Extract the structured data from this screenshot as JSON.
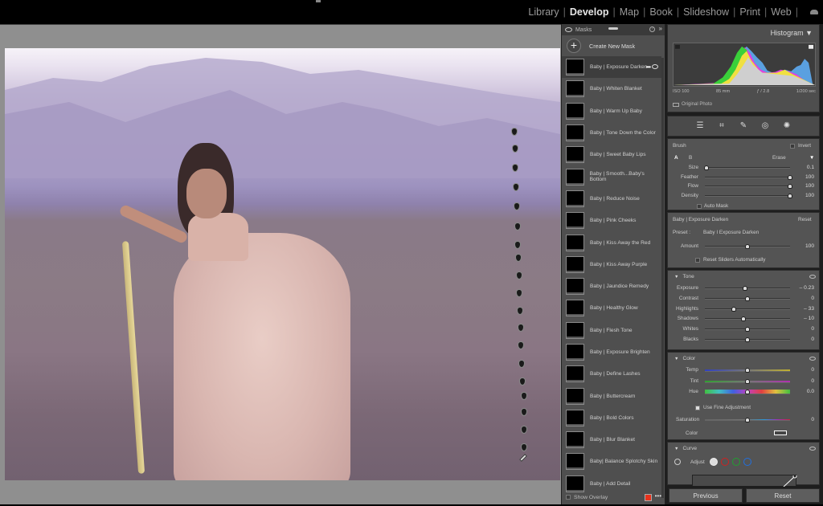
{
  "modules": {
    "items": [
      "Library",
      "Develop",
      "Map",
      "Book",
      "Slideshow",
      "Print",
      "Web"
    ],
    "active": "Develop"
  },
  "masks_panel": {
    "title": "Masks",
    "create_label": "Create New Mask",
    "items": [
      "Baby | Exposure Darken",
      "Baby | Whiten Blanket",
      "Baby | Warm Up Baby",
      "Baby | Tone Down the Color",
      "Baby | Sweet Baby Lips",
      "Baby | Smooth...Baby's Bottom",
      "Baby | Reduce Noise",
      "Baby | Pink Cheeks",
      "Baby | Kiss Away the Red",
      "Baby | Kiss Away Purple",
      "Baby | Jaundice Remedy",
      "Baby | Healthy Glow",
      "Baby | Flesh Tone",
      "Baby | Exposure Brighten",
      "Baby | Define Lashes",
      "Baby | Buttercream",
      "Baby | Bold Colors",
      "Baby | Blur Blanket",
      "Baby| Balance Splotchy Skin",
      "Baby | Add Detail"
    ],
    "selected_index": 0,
    "show_overlay_label": "Show Overlay",
    "overlay_color": "#e8321c"
  },
  "histogram": {
    "title": "Histogram",
    "iso": "ISO 100",
    "focal": "85 mm",
    "aperture": "ƒ / 2.8",
    "shutter": "1/200 sec",
    "original_label": "Original Photo"
  },
  "brush": {
    "title": "Brush",
    "invert_label": "Invert",
    "tab_a": "A",
    "tab_b": "B",
    "erase_label": "Erase",
    "sliders": [
      {
        "label": "Size",
        "value": "0.1",
        "pos": 0.02
      },
      {
        "label": "Feather",
        "value": "100",
        "pos": 1.0
      },
      {
        "label": "Flow",
        "value": "100",
        "pos": 1.0
      },
      {
        "label": "Density",
        "value": "100",
        "pos": 1.0
      }
    ],
    "auto_mask_label": "Auto Mask"
  },
  "preset": {
    "mask_name": "Baby | Exposure Darken",
    "reset_label": "Reset",
    "preset_label": "Preset :",
    "preset_value": "Baby I Exposure Darken",
    "amount_label": "Amount",
    "amount_value": "100",
    "amount_pos": 0.5,
    "reset_sliders_label": "Reset Sliders Automatically"
  },
  "tone": {
    "title": "Tone",
    "sliders": [
      {
        "label": "Exposure",
        "value": "– 0.23",
        "pos": 0.47
      },
      {
        "label": "Contrast",
        "value": "0",
        "pos": 0.5
      },
      {
        "label": "Highlights",
        "value": "– 33",
        "pos": 0.34
      },
      {
        "label": "Shadows",
        "value": "– 10",
        "pos": 0.45
      },
      {
        "label": "Whites",
        "value": "0",
        "pos": 0.5
      },
      {
        "label": "Blacks",
        "value": "0",
        "pos": 0.5
      }
    ]
  },
  "color": {
    "title": "Color",
    "sliders": [
      {
        "label": "Temp",
        "value": "0",
        "pos": 0.5
      },
      {
        "label": "Tint",
        "value": "0",
        "pos": 0.5
      },
      {
        "label": "Hue",
        "value": "0.0",
        "pos": 0.5
      }
    ],
    "fine_adjust_label": "Use Fine Adjustment",
    "saturation": {
      "label": "Saturation",
      "value": "0",
      "pos": 0.5
    },
    "color_label": "Color"
  },
  "curve": {
    "title": "Curve",
    "adjust_label": "Adjust"
  },
  "buttons": {
    "previous": "Previous",
    "reset": "Reset"
  }
}
